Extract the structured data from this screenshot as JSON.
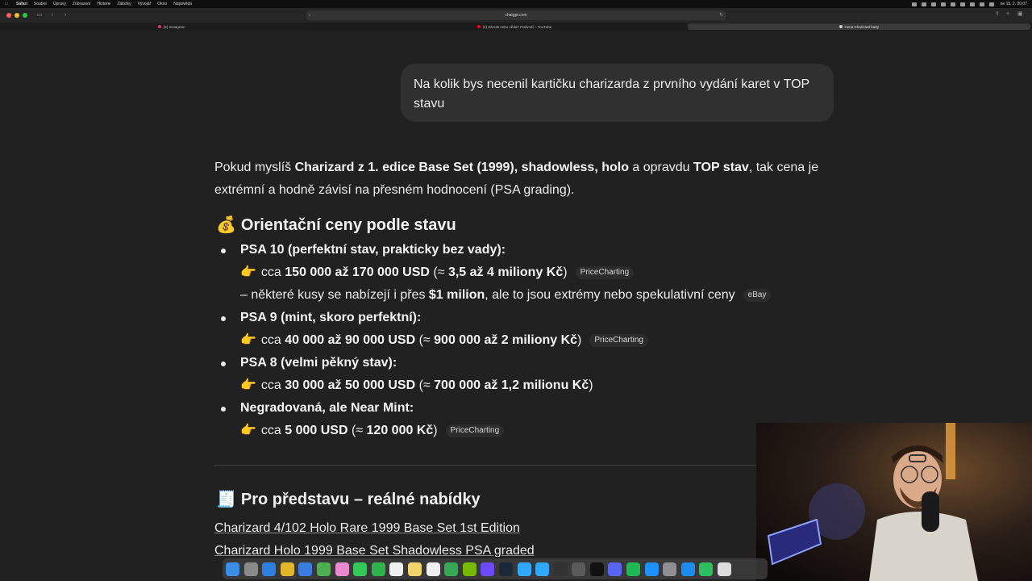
{
  "menubar": {
    "items": [
      "Safari",
      "Soubor",
      "Úpravy",
      "Zobrazení",
      "Historie",
      "Záložky",
      "Vývojář",
      "Okno",
      "Nápověda"
    ],
    "clock": "ne 15. 2.  20:07"
  },
  "browser": {
    "url": "chatgpt.com",
    "tabs": [
      {
        "label": "(5) Instagram",
        "color": "#e1306c"
      },
      {
        "label": "(4) Zázrak nebo věda? Podvodí – YouTube",
        "color": "#ff0000"
      },
      {
        "label": "Cena Charizard karty",
        "color": "#cccccc"
      }
    ]
  },
  "chat": {
    "user_message": "Na kolik bys necenil kartičku charizarda z prvního vydání karet v TOP stavu",
    "intro": {
      "t1": "Pokud myslíš ",
      "b1": "Charizard z 1. edice Base Set (1999), shadowless, holo",
      "t2": " a opravdu ",
      "b2": "TOP stav",
      "t3": ", tak cena je extrémní a hodně závisí na přesném hodnocení (PSA grading)."
    },
    "section1": {
      "emoji": "💰",
      "title": "Orientační ceny podle stavu"
    },
    "grades": {
      "psa10": {
        "label": "PSA 10 (perfektní stav, prakticky bez vady):",
        "price_prefix": "cca ",
        "price_bold": "150 000 až 170 000 USD",
        "price_paren_open": " (≈ ",
        "price_czk": "3,5 až 4 miliony Kč",
        "price_paren_close": ")",
        "source": "PriceCharting",
        "note_t1": "– některé kusy se nabízejí i přes ",
        "note_b": "$1 milion",
        "note_t2": ", ale to jsou extrémy nebo spekulativní ceny",
        "note_source": "eBay"
      },
      "psa9": {
        "label": "PSA 9 (mint, skoro perfektní):",
        "price_prefix": "cca ",
        "price_bold": "40 000 až 90 000 USD",
        "price_paren_open": " (≈ ",
        "price_czk": "900 000 až 2 miliony Kč",
        "price_paren_close": ")",
        "source": "PriceCharting"
      },
      "psa8": {
        "label": "PSA 8 (velmi pěkný stav):",
        "price_prefix": "cca ",
        "price_bold": "30 000 až 50 000 USD",
        "price_paren_open": " (≈ ",
        "price_czk": "700 000 až 1,2 milionu Kč",
        "price_paren_close": ")"
      },
      "raw": {
        "label": "Negradovaná, ale Near Mint:",
        "price_prefix": "cca ",
        "price_bold": "5 000 USD",
        "price_paren_open": " (≈ ",
        "price_czk": "120 000 Kč",
        "price_paren_close": ")",
        "source": "PriceCharting"
      }
    },
    "hand_emoji": "👉",
    "section2": {
      "emoji": "🧾",
      "title": "Pro představu – reálné nabídky"
    },
    "links": [
      "Charizard 4/102 Holo Rare 1999 Base Set 1st Edition",
      "Charizard Holo 1999 Base Set Shadowless PSA graded"
    ]
  },
  "dock_apps": [
    "finder",
    "launchpad",
    "safari",
    "chrome",
    "mail",
    "maps",
    "photos",
    "messages",
    "facetime",
    "calendar",
    "notes",
    "reminders",
    "numbers",
    "nvidia",
    "proton",
    "steam",
    "lightroom",
    "photoshop",
    "obs",
    "vpn",
    "tv",
    "discord",
    "spotify",
    "appstore",
    "settings",
    "xcode",
    "evernote",
    "preview"
  ]
}
